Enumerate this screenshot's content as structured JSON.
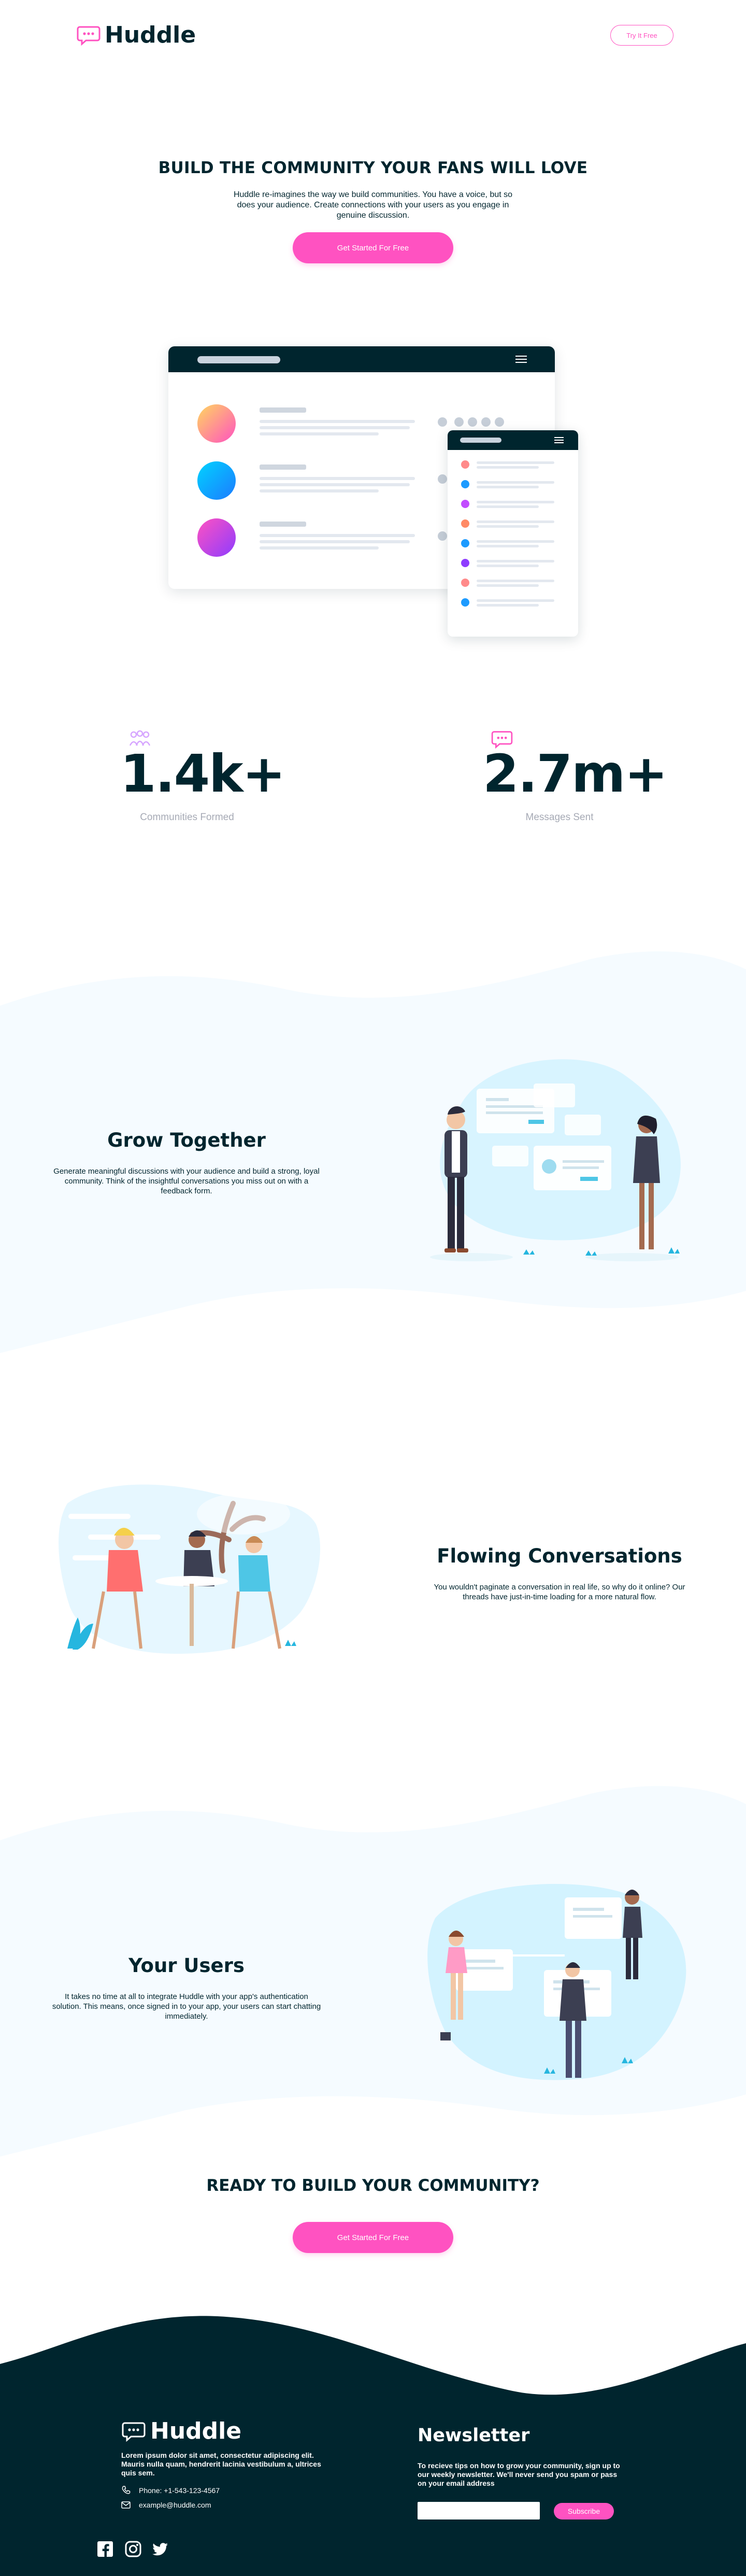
{
  "header": {
    "logo_text": "Huddle",
    "try_button": "Try It Free"
  },
  "hero": {
    "title": "BUILD THE COMMUNITY YOUR FANS WILL LOVE",
    "description": "Huddle re-imagines the way we build communities. You have a voice, but so does your audience. Create connections with your users as you engage in genuine discussion.",
    "cta": "Get Started For Free"
  },
  "stats": [
    {
      "value": "1.4k+",
      "label": "Communities Formed",
      "icon": "community-icon"
    },
    {
      "value": "2.7m+",
      "label": "Messages Sent",
      "icon": "chat-bubble-icon"
    }
  ],
  "features": [
    {
      "title": "Grow Together",
      "description": "Generate meaningful discussions with your audience and build a strong, loyal community. Think of the insightful conversations you miss out on with a feedback form."
    },
    {
      "title": "Flowing Conversations",
      "description": "You wouldn't paginate a conversation in real life, so why do it online? Our threads have just-in-time loading for a more natural flow."
    },
    {
      "title": "Your Users",
      "description": "It takes no time at all to integrate Huddle with your app's authentication solution. This means, once signed in to your app, your users can start chatting immediately."
    }
  ],
  "cta_section": {
    "title": "READY TO BUILD YOUR COMMUNITY?",
    "cta": "Get Started For Free"
  },
  "footer": {
    "logo_text": "Huddle",
    "about": "Lorem ipsum dolor sit amet, consectetur adipiscing elit. Mauris nulla quam, hendrerit lacinia vestibulum a, ultrices quis sem.",
    "phone": "Phone: +1-543-123-4567",
    "email": "example@huddle.com",
    "newsletter_title": "Newsletter",
    "newsletter_text": "To recieve tips on how to grow your community, sign up to our weekly newsletter. We'll never send you spam or pass on your email address",
    "subscribe": "Subscribe",
    "social": [
      "facebook-icon",
      "instagram-icon",
      "twitter-icon"
    ]
  },
  "colors": {
    "brand_pink": "#ff52c1",
    "dark_navy": "#00252e",
    "light_bg": "#f5fbff",
    "muted_grey": "#a6aab5"
  }
}
